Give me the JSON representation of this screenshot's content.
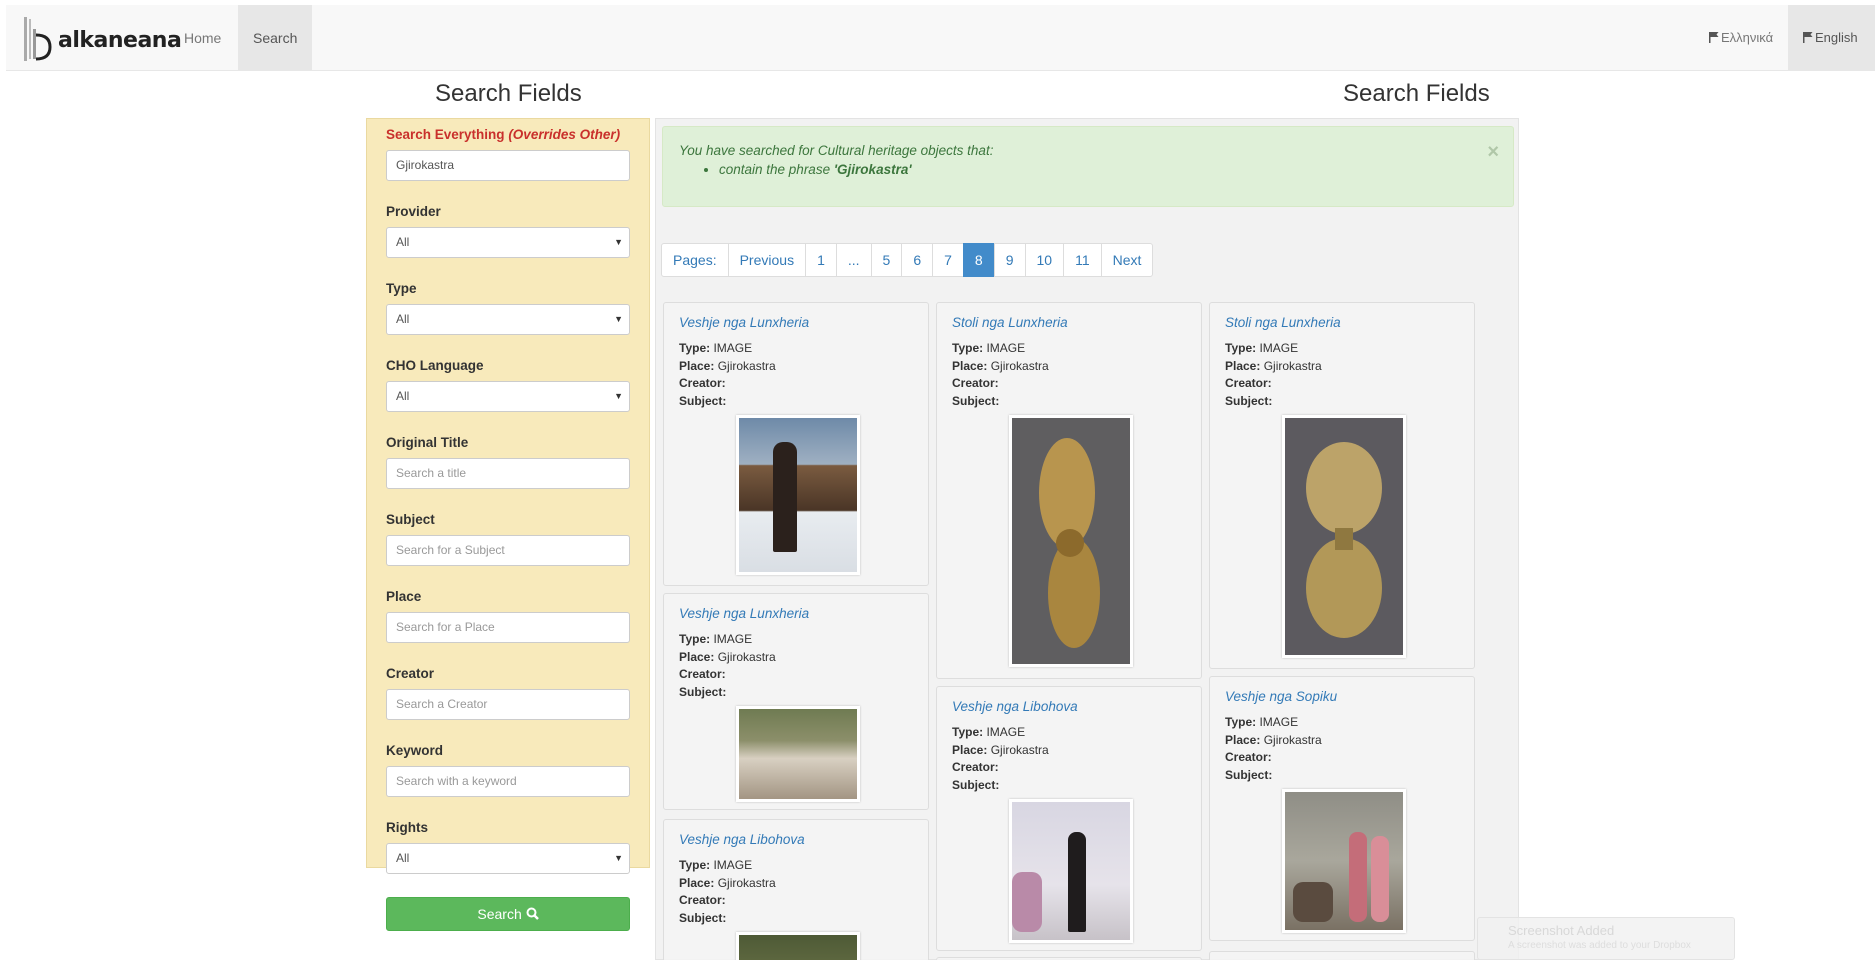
{
  "nav": {
    "logo": "alkaneana",
    "home": "Home",
    "search": "Search",
    "greek": "Ελληνικά",
    "english": "English"
  },
  "headings": {
    "left": "Search Fields",
    "right": "Search Fields"
  },
  "sidebar": {
    "everything_label": "Search Everything",
    "everything_note": "(Overrides Other)",
    "everything_value": "Gjirokastra",
    "provider_label": "Provider",
    "provider_value": "All",
    "type_label": "Type",
    "type_value": "All",
    "language_label": "CHO Language",
    "language_value": "All",
    "title_label": "Original Title",
    "title_placeholder": "Search a title",
    "subject_label": "Subject",
    "subject_placeholder": "Search for a Subject",
    "place_label": "Place",
    "place_placeholder": "Search for a Place",
    "creator_label": "Creator",
    "creator_placeholder": "Search a Creator",
    "keyword_label": "Keyword",
    "keyword_placeholder": "Search with a keyword",
    "rights_label": "Rights",
    "rights_value": "All",
    "search_button": "Search"
  },
  "alert": {
    "intro": "You have searched for Cultural heritage objects that:",
    "condition_prefix": "contain the phrase ",
    "condition_phrase": "'Gjirokastra'",
    "close": "×"
  },
  "pagination": [
    "Pages:",
    "Previous",
    "1",
    "...",
    "5",
    "6",
    "7",
    "8",
    "9",
    "10",
    "11",
    "Next"
  ],
  "pagination_active": "8",
  "meta_labels": {
    "type": "Type:",
    "place": "Place:",
    "creator": "Creator:",
    "subject": "Subject:"
  },
  "cards": [
    {
      "title": "Veshje nga Lunxheria",
      "type": "IMAGE",
      "place": "Gjirokastra"
    },
    {
      "title": "Stoli nga Lunxheria",
      "type": "IMAGE",
      "place": "Gjirokastra"
    },
    {
      "title": "Stoli nga Lunxheria",
      "type": "IMAGE",
      "place": "Gjirokastra"
    },
    {
      "title": "Veshje nga Lunxheria",
      "type": "IMAGE",
      "place": "Gjirokastra"
    },
    {
      "title": "Veshje nga Libohova",
      "type": "IMAGE",
      "place": "Gjirokastra"
    },
    {
      "title": "Veshje nga Sopiku",
      "type": "IMAGE",
      "place": "Gjirokastra"
    },
    {
      "title": "Veshje nga Libohova",
      "type": "IMAGE",
      "place": "Gjirokastra"
    }
  ],
  "toast": {
    "title": "Screenshot Added",
    "body": "A screenshot was added to your Dropbox"
  },
  "colors": {
    "sidebar_bg": "#f8eabb",
    "accent_red": "#c9302c",
    "link_blue": "#337ab7",
    "active_page": "#428bca",
    "button_green": "#5cb85c",
    "alert_bg": "#dff0d8"
  }
}
